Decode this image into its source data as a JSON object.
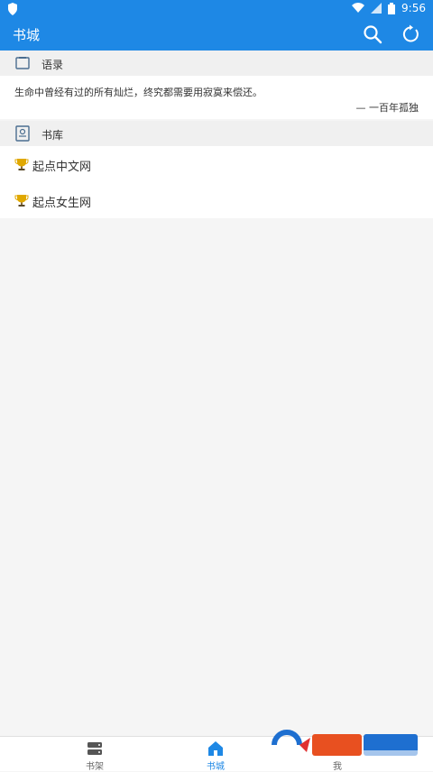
{
  "statusbar": {
    "time": "9:56",
    "icons": [
      "shield-icon",
      "wifi-icon",
      "signal-icon",
      "battery-icon"
    ]
  },
  "appbar": {
    "title": "书城",
    "actions": [
      "search-icon",
      "refresh-icon"
    ]
  },
  "sections": {
    "quotes": {
      "title": "语录",
      "icon": "quote-icon",
      "text": "生命中曾经有过的所有灿烂，终究都需要用寂寞来偿还。",
      "author": "一百年孤独"
    },
    "library": {
      "title": "书库",
      "icon": "library-icon",
      "items": [
        {
          "label": "起点中文网",
          "icon": "trophy-icon"
        },
        {
          "label": "起点女生网",
          "icon": "trophy-icon"
        }
      ]
    }
  },
  "bottom_nav": {
    "items": [
      {
        "label": "书架",
        "icon": "bookshelf-icon"
      },
      {
        "label": "书城",
        "icon": "home-icon",
        "active": true
      },
      {
        "label": "我",
        "icon": "profile-icon"
      }
    ]
  },
  "colors": {
    "primary": "#1e88e5",
    "background": "#f5f5f5",
    "section_header": "#f0f0f0"
  }
}
